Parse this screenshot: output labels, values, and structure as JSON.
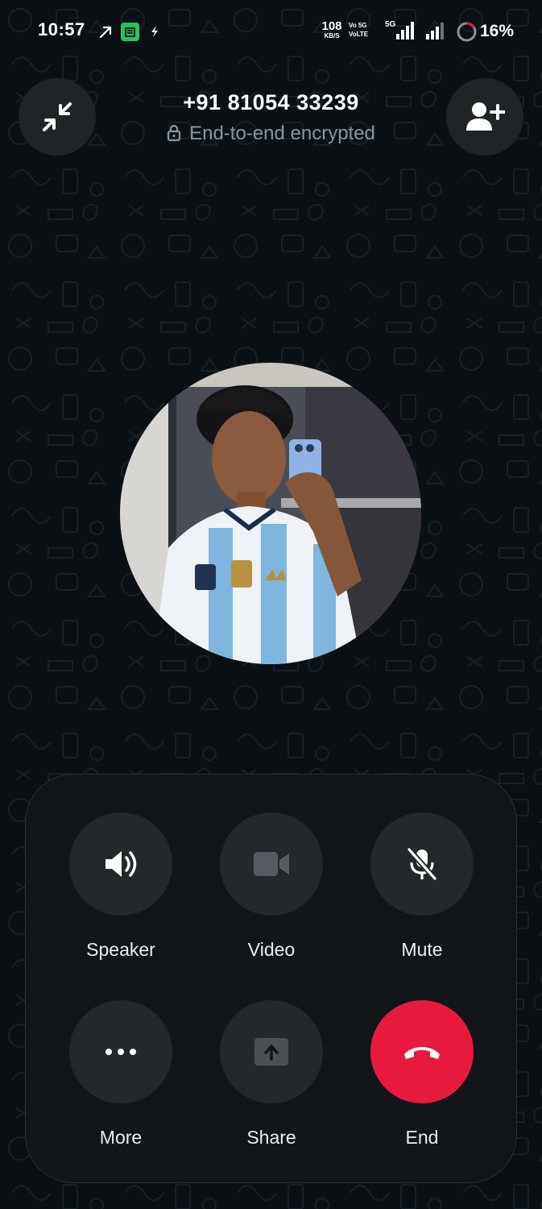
{
  "status_bar": {
    "time": "10:57",
    "net_speed_value": "108",
    "net_speed_unit": "KB/S",
    "volte_line1": "Vo 5G",
    "volte_line2": "VoLTE",
    "network_5g": "5G",
    "battery_percent": "16%",
    "battery_level": 0.16
  },
  "header": {
    "title": "+91 81054 33239",
    "subtitle": "End-to-end encrypted",
    "left_icon": "minimize-call-icon",
    "right_icon": "add-participant-icon"
  },
  "controls": [
    {
      "label": "Speaker",
      "icon": "speaker-icon"
    },
    {
      "label": "Video",
      "icon": "video-camera-icon"
    },
    {
      "label": "Mute",
      "icon": "mic-off-icon"
    },
    {
      "label": "More",
      "icon": "more-dots-icon"
    },
    {
      "label": "Share",
      "icon": "share-screen-icon"
    },
    {
      "label": "End",
      "icon": "end-call-icon"
    }
  ],
  "colors": {
    "background": "#0b1014",
    "panel": "#121619",
    "button": "#23282b",
    "end_call": "#e8193f",
    "subtitle": "#8696a0"
  }
}
